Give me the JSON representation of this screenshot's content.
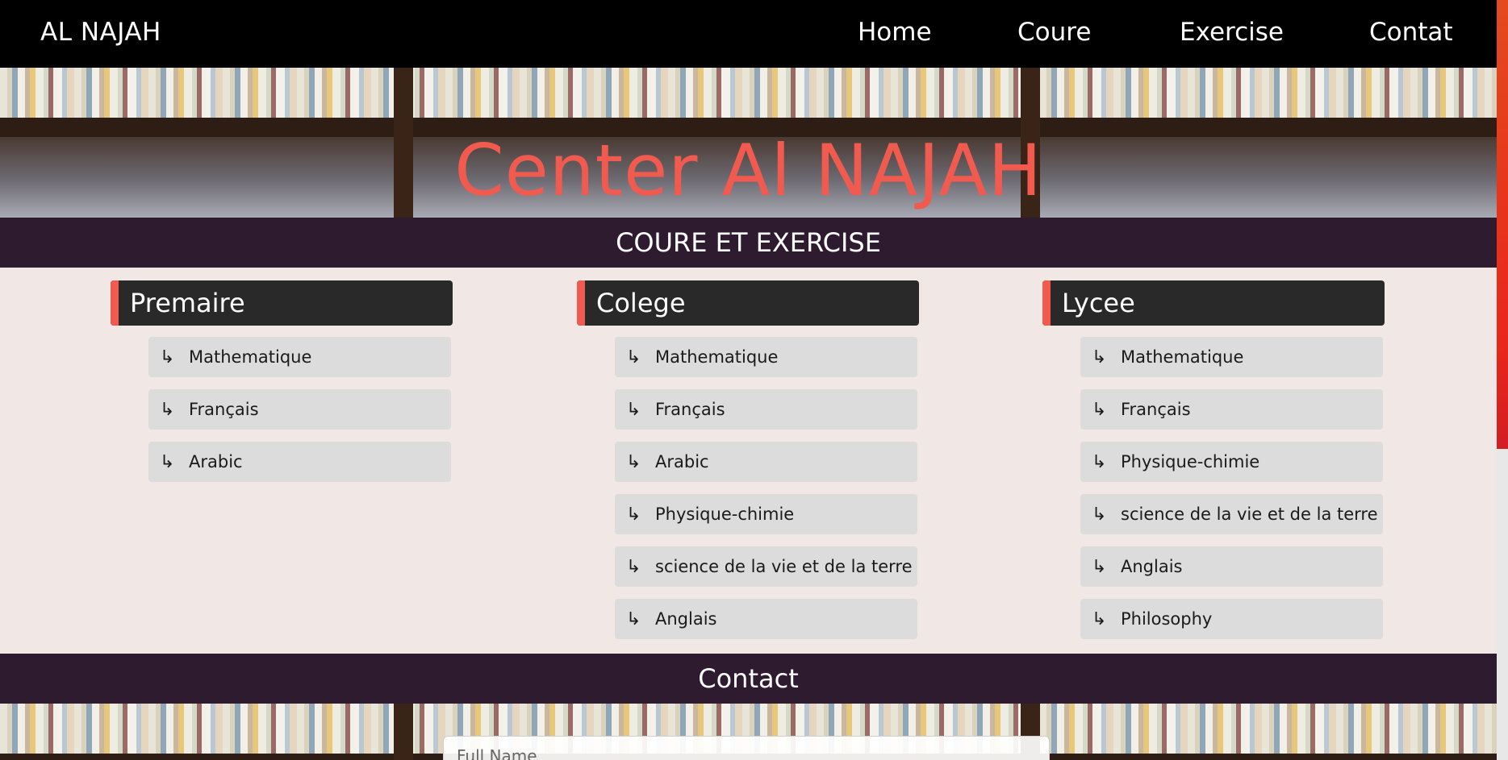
{
  "nav": {
    "brand": "AL NAJAH",
    "links": [
      "Home",
      "Coure",
      "Exercise",
      "Contat"
    ]
  },
  "hero": {
    "title": "Center Al NAJAH"
  },
  "section": {
    "title": "COURE ET EXERCISE"
  },
  "columns": [
    {
      "title": "Premaire",
      "items": [
        "Mathematique",
        "Français",
        "Arabic"
      ]
    },
    {
      "title": "Colege",
      "items": [
        "Mathematique",
        "Français",
        "Arabic",
        "Physique-chimie",
        "science de la vie et de la terre",
        "Anglais"
      ]
    },
    {
      "title": "Lycee",
      "items": [
        "Mathematique",
        "Français",
        "Physique-chimie",
        "science de la vie et de la terre",
        "Anglais",
        "Philosophy"
      ]
    }
  ],
  "contact": {
    "title": "Contact",
    "name_placeholder": "Full Name"
  },
  "icons": {
    "item_icon": "arrow-down-right-icon"
  },
  "colors": {
    "accent": "#f15a4e",
    "bar": "#2f1b2f",
    "nav": "#000000"
  }
}
